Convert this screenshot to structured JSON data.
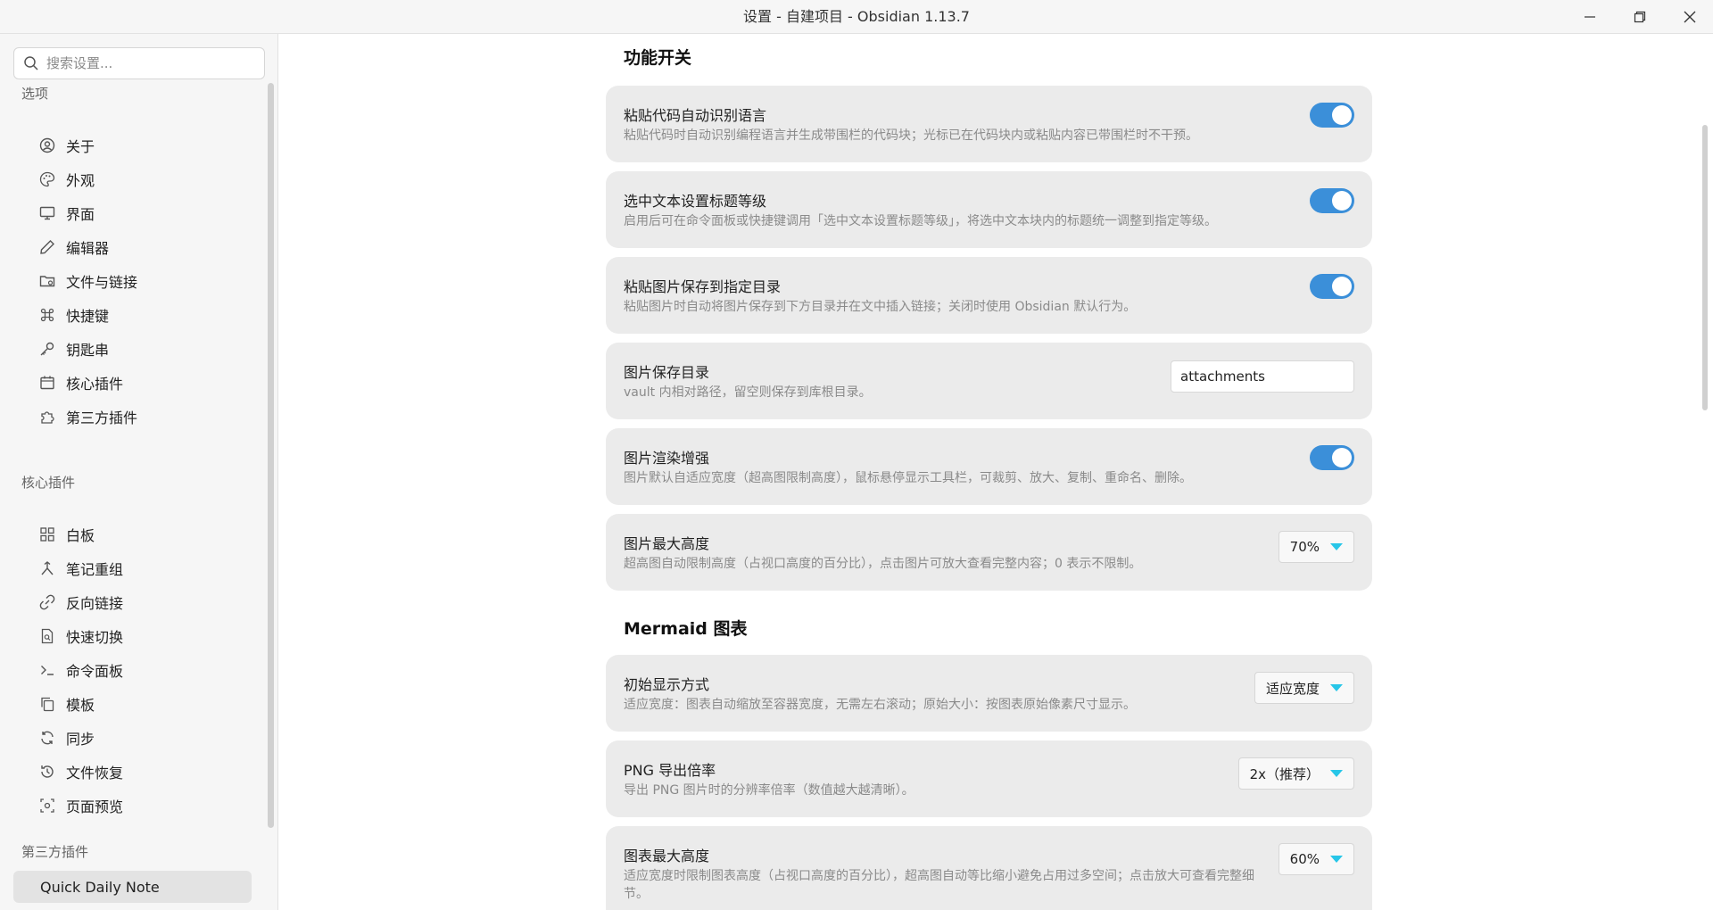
{
  "window": {
    "title": "设置 - 自建项目 - Obsidian 1.13.7"
  },
  "sidebar": {
    "search_placeholder": "搜索设置...",
    "groups": [
      {
        "title": "选项",
        "items": [
          {
            "label": "关于",
            "icon": "user-circle-icon"
          },
          {
            "label": "外观",
            "icon": "palette-icon"
          },
          {
            "label": "界面",
            "icon": "monitor-icon"
          },
          {
            "label": "编辑器",
            "icon": "pencil-icon"
          },
          {
            "label": "文件与链接",
            "icon": "folder-cog-icon"
          },
          {
            "label": "快捷键",
            "icon": "command-icon"
          },
          {
            "label": "钥匙串",
            "icon": "key-icon"
          },
          {
            "label": "核心插件",
            "icon": "calendar-plugin-icon"
          },
          {
            "label": "第三方插件",
            "icon": "puzzle-icon"
          }
        ]
      },
      {
        "title": "核心插件",
        "items": [
          {
            "label": "白板",
            "icon": "layout-grid-icon"
          },
          {
            "label": "笔记重组",
            "icon": "merge-icon"
          },
          {
            "label": "反向链接",
            "icon": "backlink-icon"
          },
          {
            "label": "快速切换",
            "icon": "file-search-icon"
          },
          {
            "label": "命令面板",
            "icon": "terminal-icon"
          },
          {
            "label": "模板",
            "icon": "copy-icon"
          },
          {
            "label": "同步",
            "icon": "refresh-icon"
          },
          {
            "label": "文件恢复",
            "icon": "history-icon"
          },
          {
            "label": "页面预览",
            "icon": "scan-eye-icon"
          }
        ]
      },
      {
        "title": "第三方插件",
        "items": [
          {
            "label": "Quick Daily Note",
            "active": true
          }
        ]
      }
    ]
  },
  "main": {
    "sections": [
      {
        "title": "功能开关",
        "settings": [
          {
            "name": "粘贴代码自动识别语言",
            "desc": "粘贴代码时自动识别编程语言并生成带围栏的代码块；光标已在代码块内或粘贴内容已带围栏时不干预。",
            "control": "toggle",
            "on": true
          },
          {
            "name": "选中文本设置标题等级",
            "desc": "启用后可在命令面板或快捷键调用「选中文本设置标题等级」，将选中文本块内的标题统一调整到指定等级。",
            "control": "toggle",
            "on": true
          },
          {
            "name": "粘贴图片保存到指定目录",
            "desc": "粘贴图片时自动将图片保存到下方目录并在文中插入链接；关闭时使用 Obsidian 默认行为。",
            "control": "toggle",
            "on": true
          },
          {
            "name": "图片保存目录",
            "desc": "vault 内相对路径，留空则保存到库根目录。",
            "control": "text",
            "value": "attachments"
          },
          {
            "name": "图片渲染增强",
            "desc": "图片默认自适应宽度（超高图限制高度），鼠标悬停显示工具栏，可裁剪、放大、复制、重命名、删除。",
            "control": "toggle",
            "on": true
          },
          {
            "name": "图片最大高度",
            "desc": "超高图自动限制高度（占视口高度的百分比），点击图片可放大查看完整内容；0 表示不限制。",
            "control": "dropdown",
            "value": "70%"
          }
        ]
      },
      {
        "title": "Mermaid 图表",
        "settings": [
          {
            "name": "初始显示方式",
            "desc": "适应宽度：图表自动缩放至容器宽度，无需左右滚动；原始大小：按图表原始像素尺寸显示。",
            "control": "dropdown",
            "value": "适应宽度"
          },
          {
            "name": "PNG 导出倍率",
            "desc": "导出 PNG 图片时的分辨率倍率（数值越大越清晰）。",
            "control": "dropdown",
            "value": "2x（推荐）"
          },
          {
            "name": "图表最大高度",
            "desc": "适应宽度时限制图表高度（占视口高度的百分比），超高图自动等比缩小避免占用过多空间；点击放大可查看完整细节。",
            "control": "dropdown",
            "value": "60%"
          }
        ]
      }
    ]
  },
  "colors": {
    "toggle_on": "#3b8fd9",
    "dropdown_caret": "#27c6e8",
    "card_bg": "#ebebeb"
  }
}
